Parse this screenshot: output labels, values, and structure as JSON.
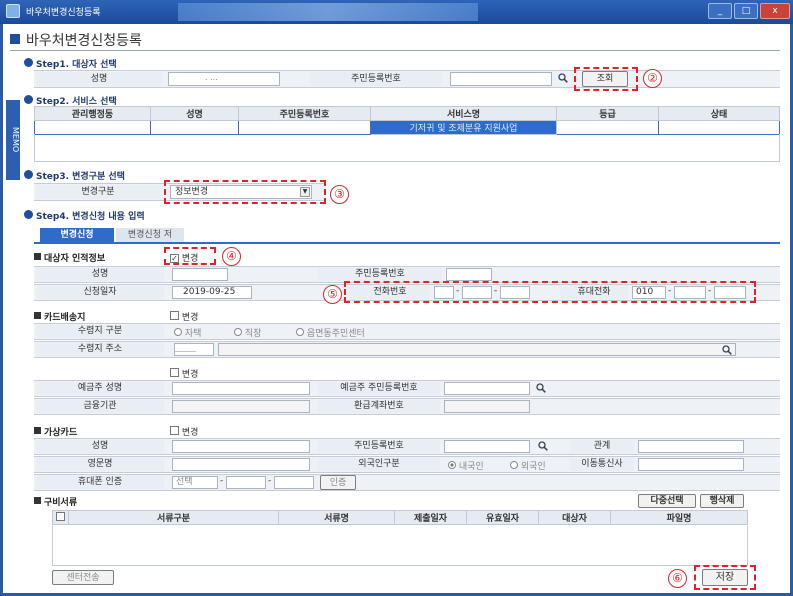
{
  "window": {
    "title": "바우처변경신청등록",
    "min": "_",
    "max": "□",
    "close": "x"
  },
  "page": {
    "title": "바우처변경신청등록"
  },
  "memo": "MEMO",
  "step1": {
    "title": "Step1. 대상자 선택",
    "name_label": "성명",
    "name_value": ".  ...",
    "rrn_label": "주민등록번호",
    "search_button": "조회",
    "callout": "②"
  },
  "step2": {
    "title": "Step2. 서비스 선택",
    "columns": [
      "관리행정동",
      "성명",
      "주민등록번호",
      "서비스명",
      "등급",
      "상태"
    ],
    "row": [
      "",
      "",
      "",
      "기저귀 및 조제분유 지원사업",
      "",
      ""
    ]
  },
  "step3": {
    "title": "Step3. 변경구분 선택",
    "label": "변경구분",
    "selected": "정보변경",
    "callout": "③"
  },
  "step4": {
    "title": "Step4. 변경신청 내용 입력",
    "tabs": [
      "변경신청",
      "변경신청 저"
    ],
    "target": {
      "section": "대상자 인적정보",
      "change_label": "변경",
      "callout": "④",
      "name_label": "성명",
      "rrn_label": "주민등록번호",
      "apply_date_label": "신청일자",
      "apply_date": "2019-09-25",
      "phone_label": "전화번호",
      "mobile_label": "휴대전화",
      "mobile_prefix": "010",
      "callout_phone": "⑤"
    },
    "card": {
      "section": "카드배송지",
      "change_label": "변경",
      "recv_type_label": "수령지 구분",
      "recv_options": [
        "자택",
        "직장",
        "읍면동주민센터"
      ],
      "recv_addr_label": "수령지 주소",
      "addr_placeholder": "______"
    },
    "account": {
      "change_label": "변경",
      "holder_label": "예금주 성명",
      "holder_rrn_label": "예금주 주민등록번호",
      "bank_label": "금융기관",
      "refund_label": "환급계좌번호"
    },
    "virtual": {
      "section": "가상카드",
      "change_label": "변경",
      "name_label": "성명",
      "rrn_label": "주민등록번호",
      "relation_label": "관계",
      "english_label": "영문명",
      "foreign_label": "외국인구분",
      "foreign_options": [
        "내국인",
        "외국인"
      ],
      "carrier_label": "이동통신사",
      "mobile_auth_label": "휴대폰 인증",
      "select_label": "선택",
      "auth_button": "인증"
    },
    "docs": {
      "section": "구비서류",
      "multi_select": "다중선택",
      "row_delete": "행삭제",
      "columns": [
        "서류구분",
        "서류명",
        "제출일자",
        "유효일자",
        "대상자",
        "파일명"
      ]
    }
  },
  "footer": {
    "center_send": "센터전송",
    "save": "저장",
    "callout": "⑥"
  },
  "colors": {
    "accent": "#1d4f9c",
    "callout": "#e2222a"
  }
}
